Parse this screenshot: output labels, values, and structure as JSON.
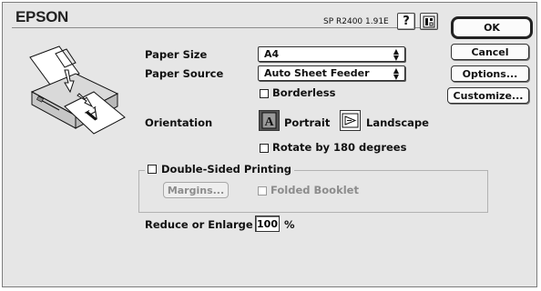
{
  "header": {
    "brand": "EPSON",
    "model": "SP R2400 1.91E",
    "help_glyph": "?",
    "icon_names": [
      "help-icon",
      "epson-tool-icon"
    ]
  },
  "form": {
    "paper_size_label": "Paper Size",
    "paper_size_value": "A4",
    "paper_source_label": "Paper Source",
    "paper_source_value": "Auto Sheet Feeder",
    "borderless_label": "Borderless",
    "borderless_checked": false,
    "orientation_label": "Orientation",
    "portrait_label": "Portrait",
    "portrait_glyph": "A",
    "landscape_label": "Landscape",
    "orientation_selected": "Portrait",
    "rotate_label": "Rotate by 180 degrees",
    "rotate_checked": false,
    "double_sided_label": "Double-Sided Printing",
    "double_sided_checked": false,
    "margins_label": "Margins...",
    "folded_booklet_label": "Folded Booklet",
    "folded_booklet_checked": false,
    "reduce_label": "Reduce or Enlarge",
    "reduce_value": "100",
    "percent": "%"
  },
  "buttons": {
    "ok": "OK",
    "cancel": "Cancel",
    "options": "Options...",
    "customize": "Customize..."
  },
  "preview": {
    "paper_glyph": "A"
  },
  "colors": {
    "panel": "#e6e6e6",
    "accent": "#111111",
    "disabled": "#8c8c8c"
  }
}
